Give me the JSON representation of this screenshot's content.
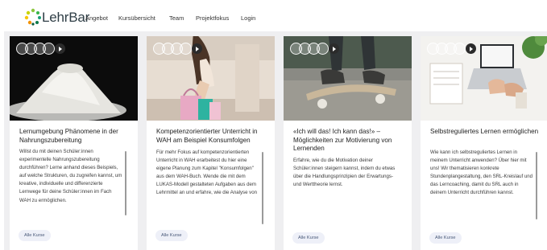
{
  "header": {
    "brand": "LehrBar",
    "nav": [
      "Angebot",
      "Kursübersicht",
      "Team",
      "Projektfokus",
      "Login"
    ]
  },
  "cards": [
    {
      "title": "Lernumgebung Phänomene in der Nahrungszubereitung",
      "description": "Willst du mit deinen Schüler:innen experimentelle Nahrungszubereitung durchführen? Lerne anhand dieses Beispiels, auf welche Strukturen, du zugreifen kannst, um kreative, individuelle und differenzierte Lernwege für deine Schüler:innen im Fach WAH zu ermöglichen.",
      "button": "Alle Kurse"
    },
    {
      "title": "Kompetenzorientierter Unterricht in WAH am Beispiel Konsumfolgen",
      "description": "Für mehr Fokus auf kompetenzorientierten Unterricht in WAH erarbeitest du hier eine eigene Planung zum Kapitel \"Konsumfolgen\" aus dem WAH-Buch. Wende die mit dem LUKAS-Modell gestalteten Aufgaben aus dem Lehrmittel an und erfahre, wie die Analyse von",
      "button": "Alle Kurse"
    },
    {
      "title": "«Ich will das! Ich kann das!» – Möglichkeiten zur Motivierung von Lernenden",
      "description": "Erfahre, wie du die Motivation deiner Schüler:innen steigern kannst, indem du etwas über die Handlungsprinzipien der Erwartungs- und Werttheorie lernst.",
      "button": "Alle Kurse"
    },
    {
      "title": "Selbstreguliertes Lernen ermöglichen",
      "description": "Wie kann ich selbstreguliertes Lernen in meinem Unterricht anwenden? Über hier mit uns! Wir thematisieren konkrete Stundenplangestaltung, den SRL-Kreislauf und das Lerncoaching, damit du SRL auch in deinem Unterricht durchführen kannst.",
      "button": "Alle Kurse"
    }
  ]
}
